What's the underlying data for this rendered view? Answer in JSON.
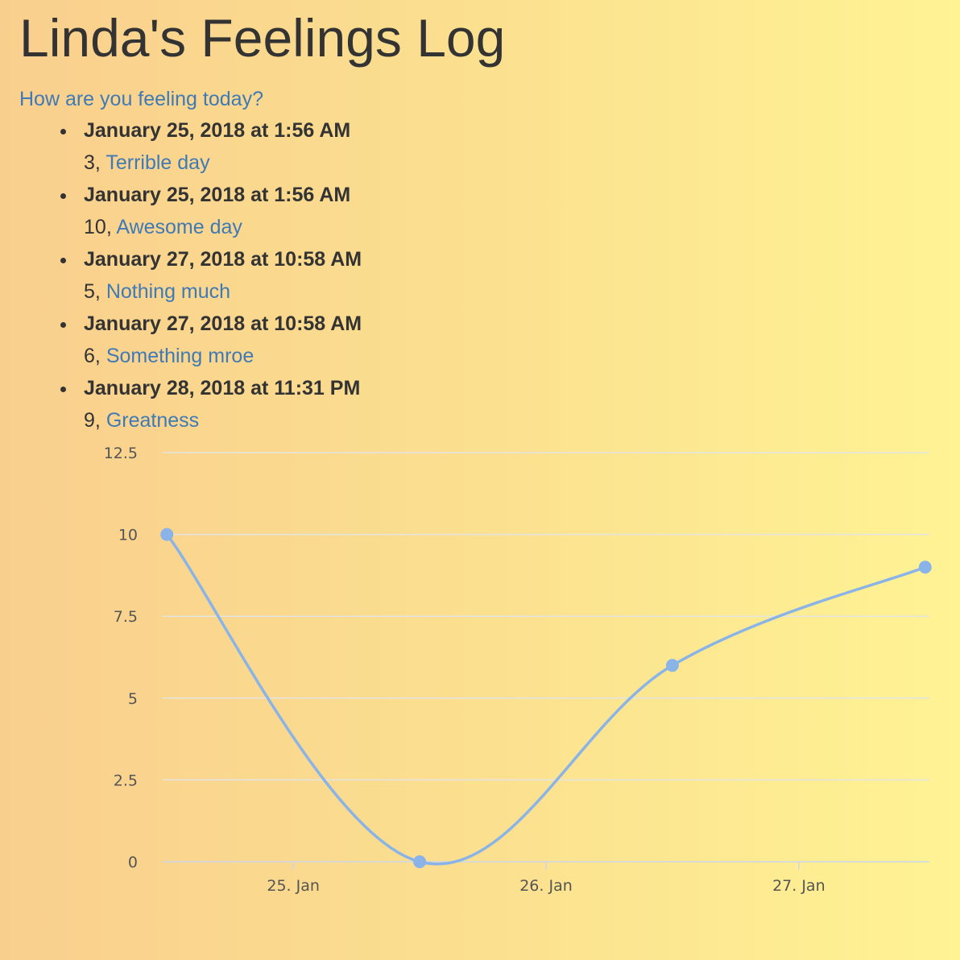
{
  "header": {
    "title": "Linda's Feelings Log",
    "prompt_link": "How are you feeling today?"
  },
  "entries": [
    {
      "date": "January 25, 2018 at 1:56 AM",
      "score": "3",
      "note": "Terrible day"
    },
    {
      "date": "January 25, 2018 at 1:56 AM",
      "score": "10",
      "note": "Awesome day"
    },
    {
      "date": "January 27, 2018 at 10:58 AM",
      "score": "5",
      "note": "Nothing much"
    },
    {
      "date": "January 27, 2018 at 10:58 AM",
      "score": "6",
      "note": "Something mroe"
    },
    {
      "date": "January 28, 2018 at 11:31 PM",
      "score": "9",
      "note": "Greatness"
    }
  ],
  "chart_data": {
    "type": "line",
    "title": "",
    "xlabel": "",
    "ylabel": "",
    "x": [
      "2018-01-24T12:00",
      "2018-01-25T12:00",
      "2018-01-26T12:00",
      "2018-01-27T12:00"
    ],
    "series": [
      {
        "values": [
          10,
          0,
          6,
          9
        ]
      }
    ],
    "xlim": [
      "2018-01-24T11:36",
      "2018-01-27T12:24"
    ],
    "ylim": [
      0,
      12.5
    ],
    "y_ticks": [
      0,
      2.5,
      5,
      7.5,
      10,
      12.5
    ],
    "y_tick_labels": [
      "0",
      "2.5",
      "5",
      "7.5",
      "10",
      "12.5"
    ],
    "x_ticks": [
      "2018-01-25",
      "2018-01-26",
      "2018-01-27"
    ],
    "x_tick_labels": [
      "25. Jan",
      "26. Jan",
      "27. Jan"
    ],
    "grid": true,
    "legend": "none",
    "curve": "smooth",
    "line_color": "#8ab4e8",
    "point_color": "#8ab4e8",
    "grid_color": "#e4e4e4"
  },
  "colors": {
    "link": "#3f7ab6",
    "text": "#333333"
  }
}
